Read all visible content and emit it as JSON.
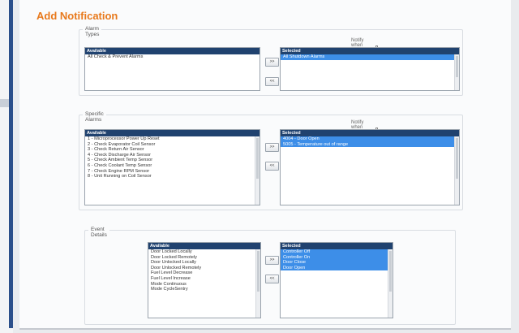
{
  "page": {
    "title": "Add Notification"
  },
  "alarm_types": {
    "legend": "Alarm Types",
    "notify_label": "Notify when Selected Cleared",
    "available_header": "Available",
    "selected_header": "Selected",
    "available_items": [
      "All Check & Prevent Alarms"
    ],
    "selected_items": [
      "All Shutdown Alarms"
    ],
    "add_button": ">>",
    "remove_button": "<<"
  },
  "specific_alarms": {
    "legend": "Specific Alarms",
    "notify_label": "Notify when Selected Cleared",
    "available_header": "Available",
    "selected_header": "Selected",
    "available_items": [
      "1 - Microprocessor Power Up Reset",
      "2 - Check Evaporator Coil Sensor",
      "3 - Check Return Air Sensor",
      "4 - Check Discharge Air Sensor",
      "5 - Check Ambient Temp Sensor",
      "6 - Check Coolant Temp Sensor",
      "7 - Check Engine RPM Sensor",
      "8 - Unit Running on Coil Sensor"
    ],
    "selected_items": [
      "4004 - Door Open",
      "5005 - Temperature out of range"
    ],
    "add_button": ">>",
    "remove_button": "<<"
  },
  "event_details": {
    "legend": "Event Details",
    "available_header": "Available",
    "selected_header": "Selected",
    "available_items": [
      "Door Locked Locally",
      "Door Locked Remotely",
      "Door Unlocked Locally",
      "Door Unlocked Remotely",
      "Fuel Level Decrease",
      "Fuel Level Increase",
      "Mode Continuous",
      "Mode CycleSentry"
    ],
    "selected_items": [
      "Controller Off",
      "Controller On",
      "Door Close",
      "Door Open"
    ],
    "add_button": ">>",
    "remove_button": "<<"
  }
}
